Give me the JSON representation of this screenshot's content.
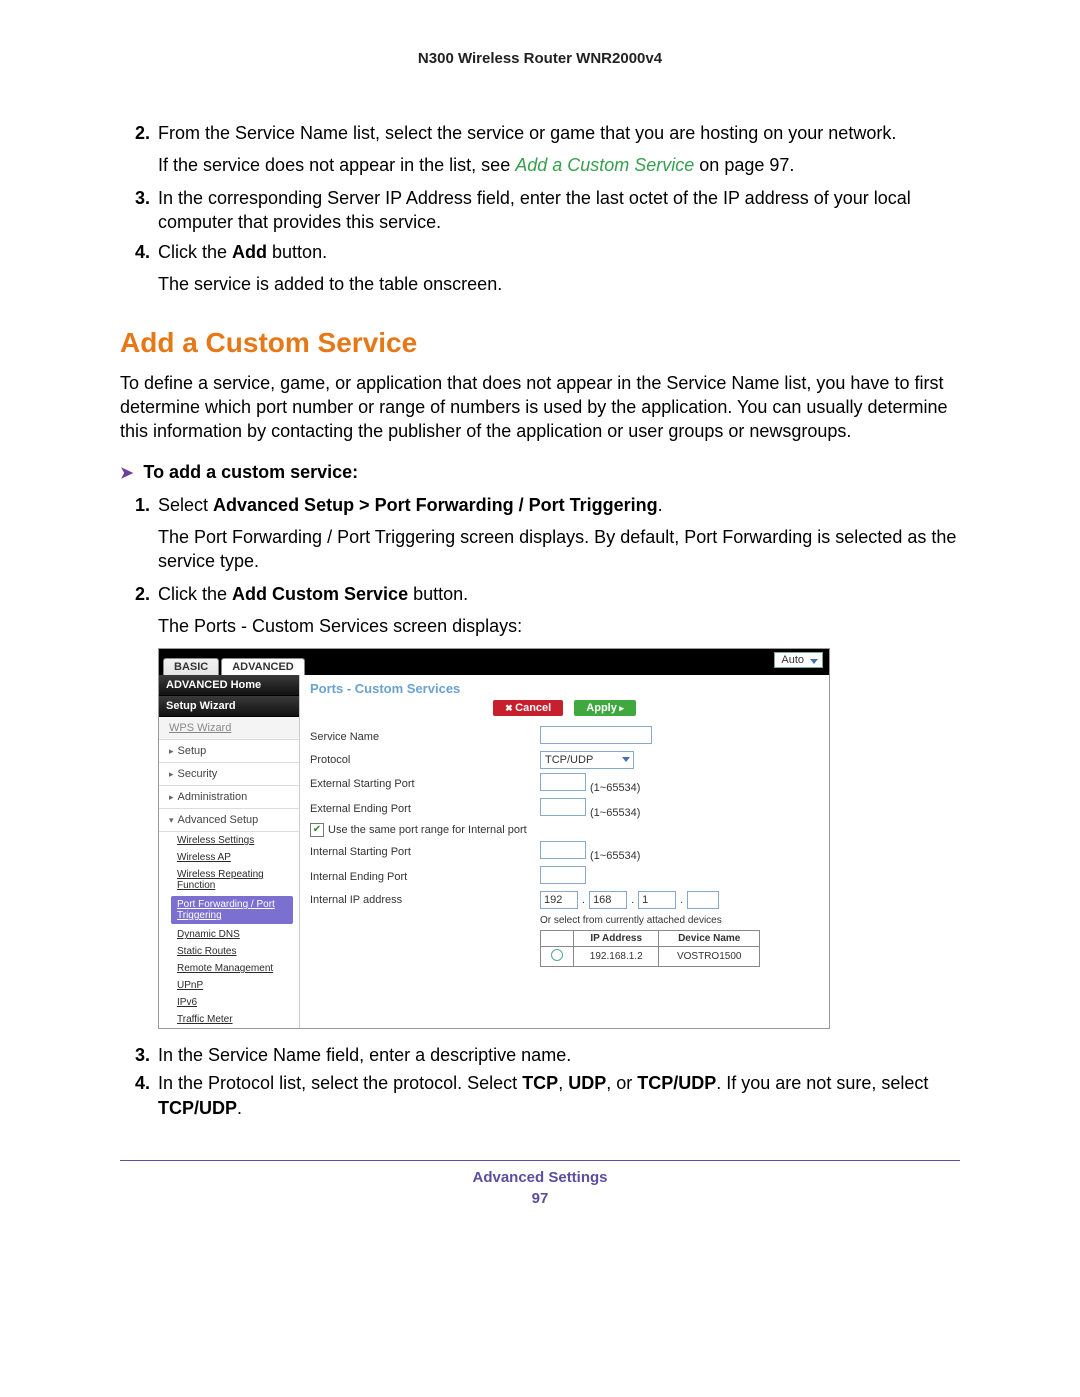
{
  "header": {
    "product": "N300 Wireless Router WNR2000v4"
  },
  "steps_a": {
    "n2": "2.",
    "body2a": "From the Service Name list, select the service or game that you are hosting on your network.",
    "body2b_pre": "If the service does not appear in the list, see ",
    "body2b_link": "Add a Custom Service",
    "body2b_post": " on page 97.",
    "n3": "3.",
    "body3": "In the corresponding Server IP Address field, enter the last octet of the IP address of your local computer that provides this service.",
    "n4": "4.",
    "body4a_pre": "Click the ",
    "body4a_bold": "Add",
    "body4a_post": " button.",
    "body4b": "The service is added to the table onscreen."
  },
  "section": {
    "heading": "Add a Custom Service",
    "intro": "To define a service, game, or application that does not appear in the Service Name list, you have to first determine which port number or range of numbers is used by the application. You can usually determine this information by contacting the publisher of the application or user groups or newsgroups."
  },
  "proc": {
    "arrow": "➤",
    "title": "To add a custom service:",
    "s1n": "1.",
    "s1_pre": "Select ",
    "s1_bold": "Advanced Setup > Port Forwarding / Port Triggering",
    "s1_post": ".",
    "s1_after": "The Port Forwarding / Port Triggering screen displays. By default, Port Forwarding is selected as the service type.",
    "s2n": "2.",
    "s2_pre": "Click the ",
    "s2_bold": "Add Custom Service",
    "s2_post": " button.",
    "s2_after": "The Ports - Custom Services screen displays:",
    "s3n": "3.",
    "s3": "In the Service Name field, enter a descriptive name.",
    "s4n": "4.",
    "s4_pre": "In the Protocol list, select the protocol. Select ",
    "s4_b1": "TCP",
    "s4_m1": ", ",
    "s4_b2": "UDP",
    "s4_m2": ", or ",
    "s4_b3": "TCP/UDP",
    "s4_m3": ". If you are not sure, select ",
    "s4_b4": "TCP/UDP",
    "s4_post": "."
  },
  "ui": {
    "tabs": {
      "basic": "BASIC",
      "advanced": "ADVANCED"
    },
    "auto": "Auto",
    "sidebar": {
      "home": "ADVANCED Home",
      "wizard": "Setup Wizard",
      "wps": "WPS Wizard",
      "setup": "Setup",
      "security": "Security",
      "admin": "Administration",
      "advsetup": "Advanced Setup",
      "subs": {
        "ws": "Wireless Settings",
        "wap": "Wireless AP",
        "wrep": "Wireless Repeating Function",
        "pfpt": "Port Forwarding / Port Triggering",
        "ddns": "Dynamic DNS",
        "sr": "Static Routes",
        "rm": "Remote Management",
        "upnp": "UPnP",
        "ipv6": "IPv6",
        "tm": "Traffic Meter"
      }
    },
    "pane": {
      "title": "Ports - Custom Services",
      "cancel": "Cancel",
      "apply": "Apply",
      "labels": {
        "svc": "Service Name",
        "proto": "Protocol",
        "protoval": "TCP/UDP",
        "esp": "External Starting Port",
        "eep": "External Ending Port",
        "same": "Use the same port range for Internal port",
        "isp": "Internal Starting Port",
        "iep": "Internal Ending Port",
        "iip": "Internal IP address",
        "range": "(1~65534)",
        "ip1": "192",
        "ip2": "168",
        "ip3": "1",
        "note": "Or select from currently attached devices",
        "th_ip": "IP Address",
        "th_dev": "Device Name",
        "row_ip": "192.168.1.2",
        "row_dev": "VOSTRO1500"
      }
    }
  },
  "footer": {
    "label": "Advanced Settings",
    "page": "97"
  }
}
